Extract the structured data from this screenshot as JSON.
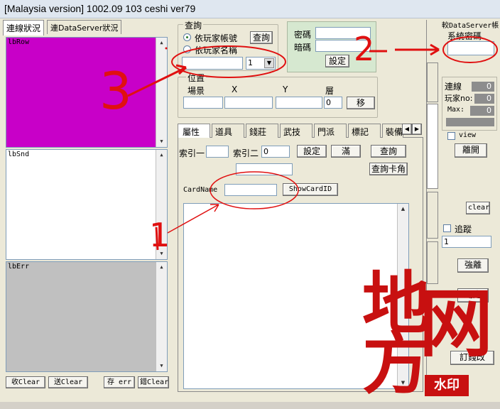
{
  "window": {
    "title": "[Malaysia version] 1002.09   103 ceshi ver79"
  },
  "left": {
    "tabs": [
      "連線狀況",
      "連DataServer狀況"
    ],
    "lb_row": "lbRow",
    "lb_snd": "lbSnd",
    "lb_err": "lbErr",
    "buttons": {
      "recv_clear": "收Clear",
      "send_clear": "送Clear",
      "save_err": "存 err",
      "err_clear": "錯Clear"
    }
  },
  "query": {
    "group_label": "查詢",
    "radio_account": "依玩家帳號",
    "radio_name": "依玩家名稱",
    "query_button": "查詢",
    "select_value": "1"
  },
  "login": {
    "password_label": "密碼",
    "dark_password_label": "暗碼",
    "set_button": "設定"
  },
  "position": {
    "group_label": "位置",
    "scene_label": "場景",
    "x_label": "X",
    "y_label": "Y",
    "layer_label": "層",
    "layer_value": "0",
    "move_button": "移"
  },
  "tabs": [
    "屬性",
    "道具",
    "錢莊",
    "武技",
    "門派",
    "標記",
    "裝備"
  ],
  "attributes": {
    "index1_label": "索引一",
    "index2_label": "索引二",
    "index2_value": "0",
    "set_button": "設定",
    "full_button": "滿",
    "query_button": "查詢",
    "query_card_button": "查詢卡角",
    "cardname_label": "CardName",
    "showcard_button": "ShowCardID"
  },
  "right": {
    "dataserver_label": "較DataServer帳",
    "system_label": "系統密碼",
    "conn_label": "連線",
    "conn_value": "0",
    "players_label": "玩家no:",
    "players_value": "0",
    "max_label": "Max:",
    "max_value": "0",
    "view_label": "view",
    "leave_button": "離開",
    "clear_button": "clear",
    "track_label": "追蹤",
    "track_value": "1",
    "force_leave_button": "強離",
    "kick_button": "踢走",
    "order_button": "訂錢改"
  },
  "annotations": {
    "arrow1": "1",
    "arrow2": "2",
    "arrow3": "3"
  },
  "watermark": {
    "c1": "地",
    "c2": "方",
    "c3": "网",
    "stamp": "水印"
  },
  "colors": {
    "lbrow_bg": "#c800c8",
    "lberr_bg": "#c0c0c0",
    "red_mark": "#e01010"
  }
}
